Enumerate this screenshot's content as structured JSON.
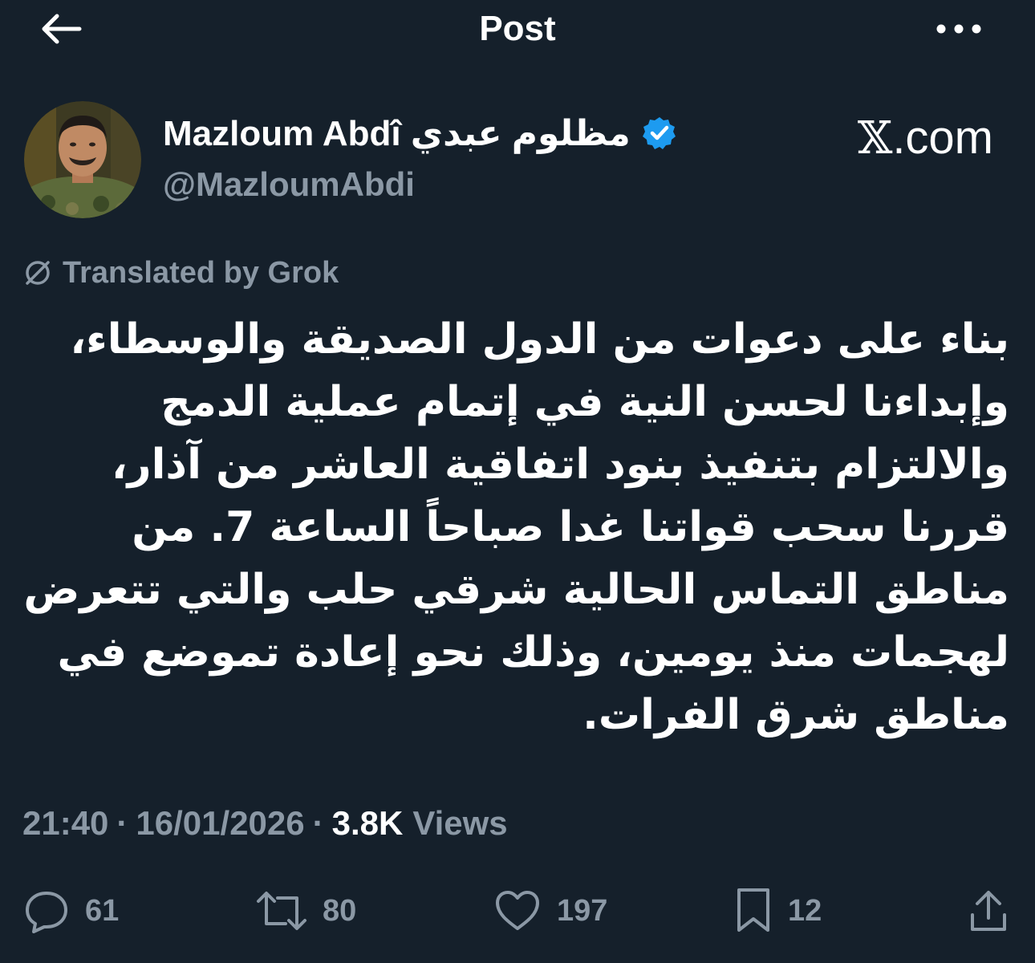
{
  "header": {
    "title": "Post",
    "back_icon": "arrow-left-icon",
    "more_icon": "ellipsis-icon"
  },
  "author": {
    "display_name": "Mazloum Abdî مظلوم عبدي",
    "handle": "@MazloumAbdi",
    "verified": true
  },
  "watermark": {
    "x_glyph": "𝕏",
    "suffix": ".com"
  },
  "translation": {
    "label": "Translated by Grok"
  },
  "post": {
    "text": "بناء على دعوات من الدول الصديقة والوسطاء، وإبداءنا لحسن النية في إتمام عملية الدمج والالتزام بتنفيذ بنود اتفاقية العاشر من آذار، قررنا سحب قواتنا غدا صباحاً الساعة 7. من مناطق التماس الحالية شرقي حلب والتي تتعرض لهجمات منذ يومين، وذلك نحو إعادة تموضع في مناطق شرق الفرات."
  },
  "meta": {
    "time": "21:40",
    "separator": "·",
    "date": "16/01/2026",
    "views_count": "3.8K",
    "views_label": "Views"
  },
  "actions": {
    "replies": "61",
    "reposts": "80",
    "likes": "197",
    "bookmarks": "12"
  },
  "colors": {
    "background": "#15202b",
    "text": "#ffffff",
    "secondary": "#8b98a5",
    "verified": "#1d9bf0"
  }
}
